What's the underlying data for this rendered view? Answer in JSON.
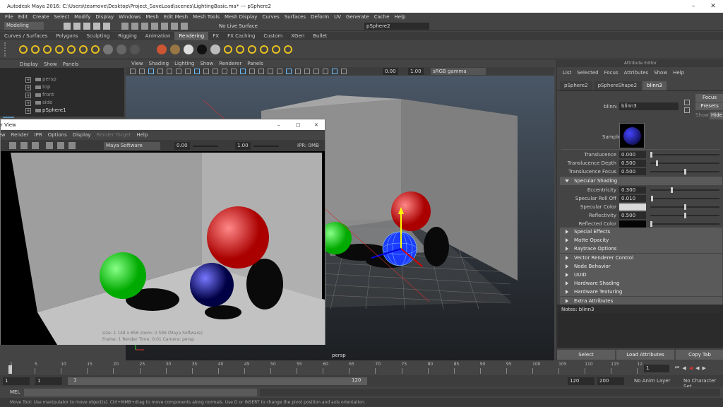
{
  "window": {
    "title": "Autodesk Maya 2016: C:\\Users\\teamove\\Desktop\\Project_SaveLoad\\scenes\\LightingBasic.ma* --- pSphere2"
  },
  "menubar": [
    "File",
    "Edit",
    "Create",
    "Select",
    "Modify",
    "Display",
    "Windows",
    "Mesh",
    "Edit Mesh",
    "Mesh Tools",
    "Mesh Display",
    "Curves",
    "Surfaces",
    "Deform",
    "UV",
    "Generate",
    "Cache",
    "Help"
  ],
  "status": {
    "mode": "Modeling",
    "live_surface": "No Live Surface",
    "object_name": "pSphere2"
  },
  "shelf_tabs": [
    {
      "label": "Curves / Surfaces",
      "active": false
    },
    {
      "label": "Polygons",
      "active": false
    },
    {
      "label": "Sculpting",
      "active": false
    },
    {
      "label": "Rigging",
      "active": false
    },
    {
      "label": "Animation",
      "active": false
    },
    {
      "label": "Rendering",
      "active": true
    },
    {
      "label": "FX",
      "active": false
    },
    {
      "label": "FX Caching",
      "active": false
    },
    {
      "label": "Custom",
      "active": false
    },
    {
      "label": "XGen",
      "active": false
    },
    {
      "label": "Bullet",
      "active": false
    }
  ],
  "shelf_icons": [
    {
      "name": "point-light-icon",
      "color": "#e8c020"
    },
    {
      "name": "directional-light-icon",
      "color": "#e8c020"
    },
    {
      "name": "spot-light-icon",
      "color": "#e8c020"
    },
    {
      "name": "area-light-icon",
      "color": "#e8c020"
    },
    {
      "name": "volume-light-icon",
      "color": "#e8c020"
    },
    {
      "name": "ambient-light-icon",
      "color": "#e8c020"
    },
    {
      "name": "sphere-light-icon",
      "color": "#e8c020"
    },
    {
      "name": "blinn-material-icon",
      "color": "#777777"
    },
    {
      "name": "lambert-material-icon",
      "color": "#666666"
    },
    {
      "name": "phong-material-icon",
      "color": "#555555"
    },
    {
      "name": "anisotropic-material-icon",
      "color": "#444444"
    },
    {
      "name": "ramp-material-icon",
      "color": "#cc5533"
    },
    {
      "name": "layered-material-icon",
      "color": "#997744"
    },
    {
      "name": "surface-shader-icon",
      "color": "#dddddd"
    },
    {
      "name": "use-background-icon",
      "color": "#111111"
    },
    {
      "name": "shading-map-icon",
      "color": "#bbbbbb"
    },
    {
      "name": "render-settings-icon",
      "color": "#e8c020"
    },
    {
      "name": "render-view-icon",
      "color": "#e8c020"
    },
    {
      "name": "ipr-render-icon",
      "color": "#e8c020"
    },
    {
      "name": "render-frame-icon",
      "color": "#e8c020"
    },
    {
      "name": "hypershade-icon",
      "color": "#e8c020"
    },
    {
      "name": "render-target-icon",
      "color": "#e8c020"
    }
  ],
  "outliner": {
    "menu": [
      "Display",
      "Show",
      "Panels"
    ],
    "items": [
      "persp",
      "top",
      "front",
      "side",
      "pSphere1"
    ]
  },
  "viewport": {
    "menu": [
      "View",
      "Shading",
      "Lighting",
      "Show",
      "Renderer",
      "Panels"
    ],
    "exposure": "0.00",
    "gamma": "1.00",
    "colorspace": "sRGB gamma",
    "camera": "persp"
  },
  "render_view": {
    "title": "Render View",
    "menu": [
      "View",
      "Render",
      "IPR",
      "Options",
      "Display",
      "Render Target",
      "Help"
    ],
    "renderer": "Maya Software",
    "exposure": "0.00",
    "gamma": "1.00",
    "ipr": "IPR: 0MB",
    "info_line1": "size: 1 148 x 856  zoom: 0.599        (Maya Software)",
    "info_line2": "Frame: 1        Render Time: 0:01        Camera: persp"
  },
  "attribute_editor": {
    "header": "Attribute Editor",
    "menu": [
      "List",
      "Selected",
      "Focus",
      "Attributes",
      "Show",
      "Help"
    ],
    "tabs": [
      {
        "label": "pSphere2",
        "active": false
      },
      {
        "label": "pSphereShape2",
        "active": false
      },
      {
        "label": "blinn3",
        "active": true
      }
    ],
    "node_label": "blinn:",
    "node_name": "blinn3",
    "focus": "Focus",
    "presets": "Presets",
    "show": "Show",
    "hide": "Hide",
    "sample_label": "Sample",
    "translucence": [
      {
        "label": "Translucence",
        "value": "0.000",
        "pos": 0.0
      },
      {
        "label": "Translucence Depth",
        "value": "0.500",
        "pos": 0.08
      },
      {
        "label": "Translucence Focus",
        "value": "0.500",
        "pos": 0.5
      }
    ],
    "specular_section": "Specular Shading",
    "specular": [
      {
        "label": "Eccentricity",
        "value": "0.300",
        "pos": 0.3,
        "type": "slider"
      },
      {
        "label": "Specular Roll Off",
        "value": "0.010",
        "pos": 0.01,
        "type": "slider"
      },
      {
        "label": "Specular Color",
        "value": "",
        "pos": 0.5,
        "type": "color",
        "color": "#d9d9d9"
      },
      {
        "label": "Reflectivity",
        "value": "0.500",
        "pos": 0.5,
        "type": "slider"
      },
      {
        "label": "Reflected Color",
        "value": "",
        "pos": 0.0,
        "type": "color",
        "color": "#050505"
      }
    ],
    "sections": [
      "Special Effects",
      "Matte Opacity",
      "Raytrace Options",
      "Vector Renderer Control",
      "Node Behavior",
      "UUID",
      "Hardware Shading",
      "Hardware Texturing",
      "Extra Attributes"
    ],
    "notes": "Notes:  blinn3",
    "buttons": [
      "Select",
      "Load Attributes",
      "Copy Tab"
    ]
  },
  "timeline": {
    "ticks": [
      "1",
      "5",
      "10",
      "15",
      "20",
      "25",
      "30",
      "35",
      "40",
      "45",
      "50",
      "55",
      "60",
      "65",
      "70",
      "75",
      "80",
      "85",
      "90",
      "95",
      "100",
      "105",
      "110",
      "115",
      "12"
    ],
    "current_frame": "1",
    "range_start": "1",
    "range_start2": "1",
    "range_mid": "1",
    "range_end": "120",
    "range_end_a": "120",
    "range_end_b": "200",
    "anim_layer": "No Anim Layer",
    "character_set": "No Character Set"
  },
  "command": {
    "label": "MEL"
  },
  "helpline": "Move Tool: Use manipulator to move object(s). Ctrl+MMB+drag to move components along normals. Use D or INSERT to change the pivot position and axis orientation."
}
